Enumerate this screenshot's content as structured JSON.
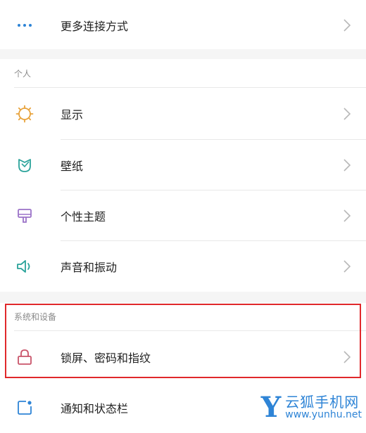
{
  "settings": {
    "more_connections": {
      "label": "更多连接方式",
      "icon": "more-dots-icon"
    },
    "personal_section": {
      "title": "个人",
      "items": [
        {
          "label": "显示",
          "icon": "sun-icon"
        },
        {
          "label": "壁纸",
          "icon": "wallpaper-tulip-icon"
        },
        {
          "label": "个性主题",
          "icon": "theme-brush-icon"
        },
        {
          "label": "声音和振动",
          "icon": "speaker-icon"
        }
      ]
    },
    "system_section": {
      "title": "系统和设备",
      "items": [
        {
          "label": "锁屏、密码和指纹",
          "icon": "lock-icon"
        },
        {
          "label": "通知和状态栏",
          "icon": "notification-icon"
        }
      ]
    }
  },
  "watermark": {
    "letter": "Y",
    "name": "云狐手机网",
    "url": "www.yunhu.net"
  },
  "colors": {
    "accent_blue": "#2e84d6",
    "highlight_red": "#e0282b",
    "icon_orange": "#e8a33c",
    "icon_teal": "#2aa39a",
    "icon_purple": "#9b72c8",
    "icon_lock": "#c9546a"
  }
}
